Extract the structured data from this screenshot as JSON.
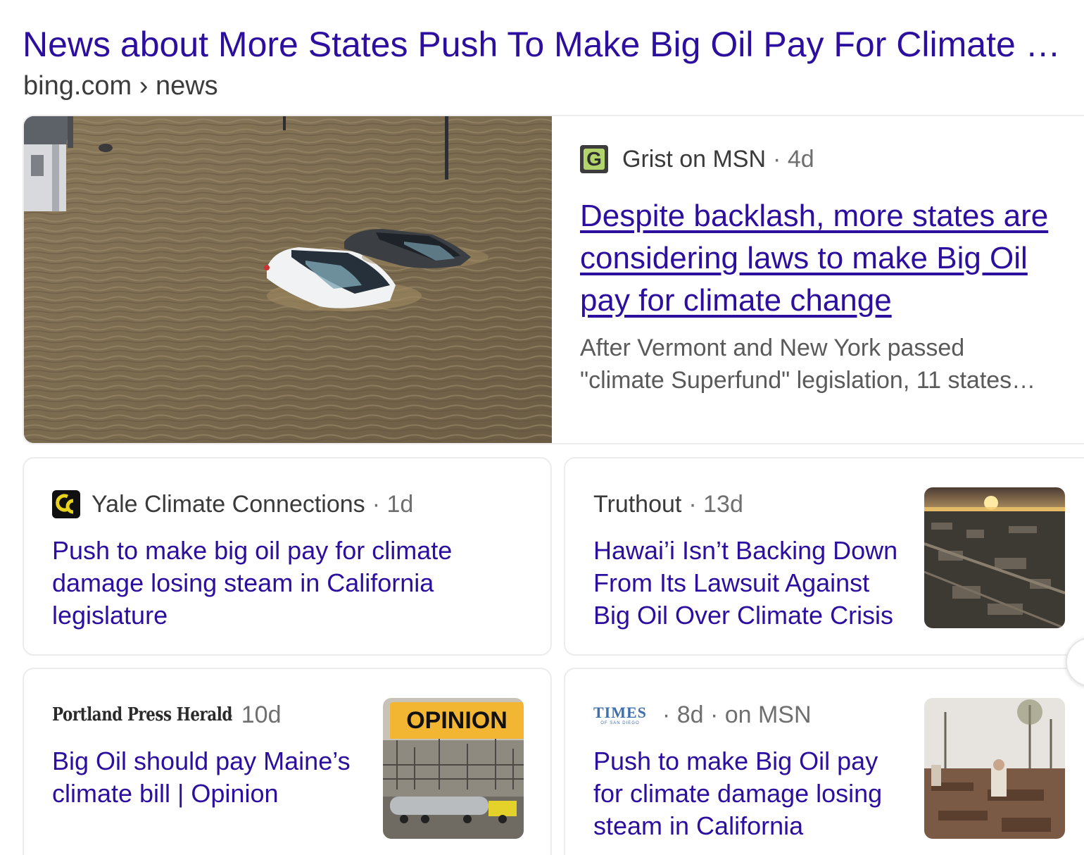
{
  "header": {
    "title": "News about More States Push To Make Big Oil Pay For Climate C…",
    "breadcrumb": "bing.com › news"
  },
  "featured": {
    "source": "Grist on MSN",
    "meta": "· 4d",
    "logo_letter": "G",
    "headline": "Despite backlash, more states are considering laws to make Big Oil pay for climate change",
    "snippet_line1": "After Vermont and New York passed",
    "snippet_line2": "\"climate Superfund\" legislation, 11 states…",
    "image": "flooded-cars-photo"
  },
  "cards": [
    {
      "source": "Yale Climate Connections",
      "meta": "· 1d",
      "headline": "Push to make big oil pay for climate damage losing steam in California legislature"
    },
    {
      "source": "Truthout",
      "meta": "· 13d",
      "headline": "Hawai’i Isn’t Backing Down From Its Lawsuit Against Big Oil Over Climate Crisis",
      "image": "sunset-burned-town-photo"
    },
    {
      "source": "Portland Press Herald",
      "meta": "· 10d",
      "headline": "Big Oil should pay Maine’s climate bill | Opinion",
      "badge": "OPINION",
      "image": "refinery-tanker-truck-photo"
    },
    {
      "source_logo_top": "TIMES",
      "source_logo_bottom": "OF SAN DIEGO",
      "meta": "· 8d · on MSN",
      "headline": "Push to make Big Oil pay for climate damage losing steam in California",
      "image": "fire-debris-photo"
    }
  ],
  "colors": {
    "link": "#2c0f9e",
    "text": "#3a3a3a",
    "muted": "#6f6f6f",
    "opinion_badge": "#f2b632",
    "grist_logo": "#b3d46c",
    "yale_logo_accent": "#e8d21d"
  }
}
